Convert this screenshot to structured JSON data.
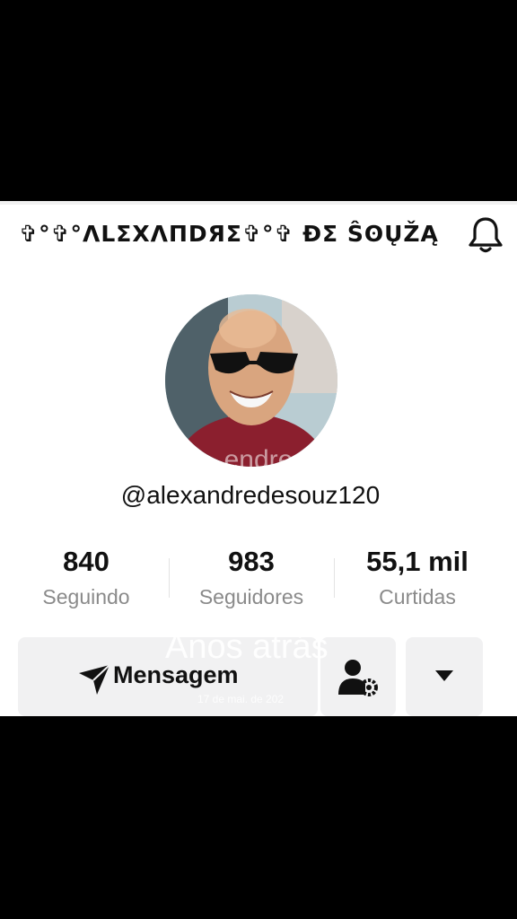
{
  "profile": {
    "display_name": "✞°✞°ΛLΣXΛПDЯΣ✞°✞ ÐΣ ŜʘŲŽĄ",
    "handle": "@alexandredesouz120",
    "avatar_icon": "profile-photo"
  },
  "header": {
    "bell_icon": "notification-bell-icon"
  },
  "stats": [
    {
      "value": "840",
      "label": "Seguindo"
    },
    {
      "value": "983",
      "label": "Seguidores"
    },
    {
      "value": "55,1 mil",
      "label": "Curtidas"
    }
  ],
  "actions": {
    "message_label": "Mensagem",
    "message_icon": "paper-plane-icon",
    "add_friend_icon": "person-settings-icon",
    "more_icon": "caret-down-icon"
  },
  "video_overlay": {
    "name_fragment": "endre",
    "years_text": "Anos atrás",
    "date_text": "17 de mai. de 202"
  },
  "colors": {
    "background": "#000000",
    "card": "#ffffff",
    "button": "#f1f1f2",
    "label_gray": "#8a8a8a"
  }
}
